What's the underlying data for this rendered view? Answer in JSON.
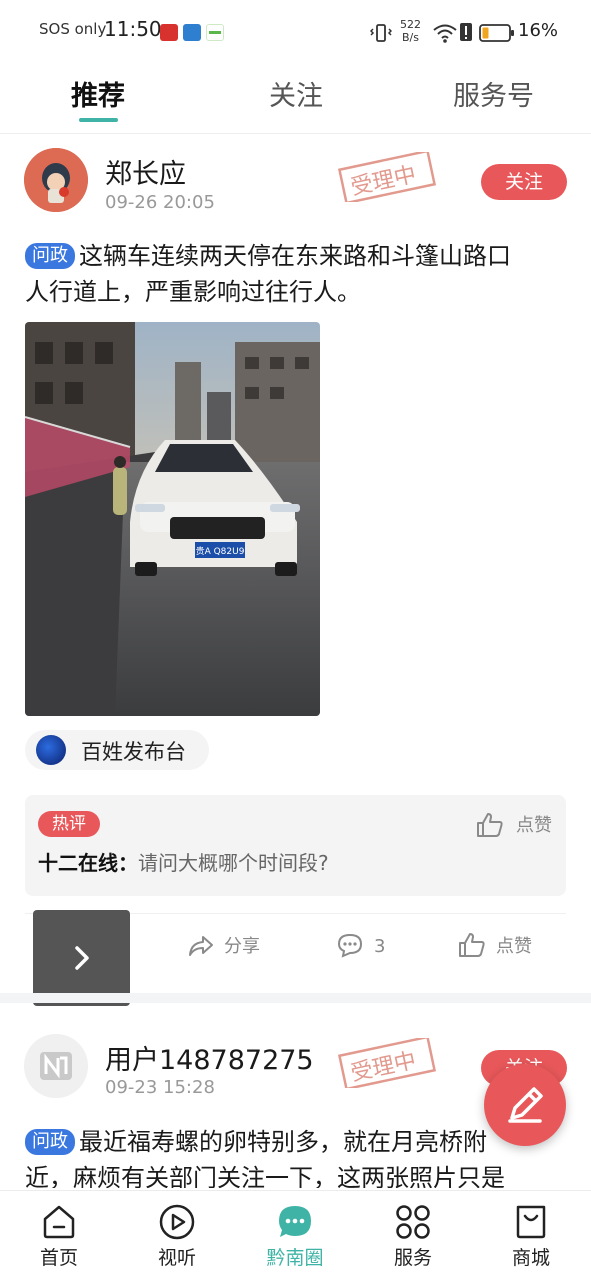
{
  "status_bar": {
    "carrier": "SOS only",
    "time": "11:50",
    "net_speed_value": "522",
    "net_speed_unit": "B/s",
    "battery": "16%"
  },
  "top_tabs": [
    {
      "label": "推荐",
      "active": true
    },
    {
      "label": "关注",
      "active": false
    },
    {
      "label": "服务号",
      "active": false
    }
  ],
  "posts": [
    {
      "author": "郑长应",
      "time": "09-26 20:05",
      "stamp": "受理中",
      "follow_label": "关注",
      "tag": "问政",
      "text_line1": "这辆车连续两天停在东来路和斗篷山路口",
      "text_line2": "人行道上，严重影响过往行人。",
      "plate": "贵A Q82U9",
      "source": "百姓发布台",
      "hot_comment": {
        "tag": "热评",
        "user": "十二在线：",
        "text": "请问大概哪个时间段?",
        "like_label": "点赞"
      },
      "actions": {
        "share": "分享",
        "comments": "3",
        "like": "点赞"
      }
    },
    {
      "author": "用户148787275",
      "time": "09-23 15:28",
      "stamp": "受理中",
      "follow_label": "关注",
      "tag": "问政",
      "text_line1": "最近福寿螺的卵特别多，就在月亮桥附",
      "text_line2": "近，麻烦有关部门关注一下，这两张照片只是"
    }
  ],
  "bottom_nav": [
    {
      "label": "首页",
      "icon": "home-icon",
      "active": false
    },
    {
      "label": "视听",
      "icon": "play-icon",
      "active": false
    },
    {
      "label": "黔南圈",
      "icon": "chat-bubble-icon",
      "active": true
    },
    {
      "label": "服务",
      "icon": "grid-icon",
      "active": false
    },
    {
      "label": "商城",
      "icon": "shopping-bag-icon",
      "active": false
    }
  ],
  "colors": {
    "accent": "#3fb4a6",
    "follow": "#e8585a",
    "tag_blue": "#3a78e0",
    "stamp": "#e29a8f"
  }
}
